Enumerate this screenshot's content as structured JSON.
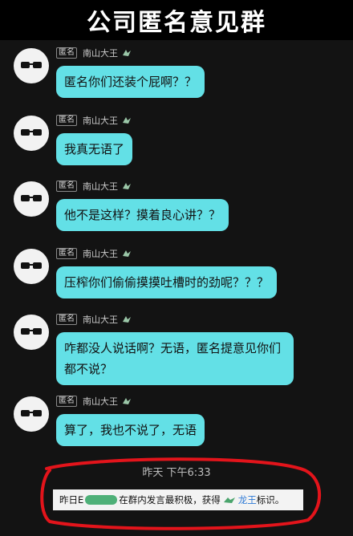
{
  "header": {
    "title": "公司匿名意见群"
  },
  "messages": [
    {
      "tag": "匿名",
      "sender": "南山大王",
      "text": "匿名你们还装个屁啊？？"
    },
    {
      "tag": "匿名",
      "sender": "南山大王",
      "text": "我真无语了"
    },
    {
      "tag": "匿名",
      "sender": "南山大王",
      "text": "他不是这样？摸着良心讲？？"
    },
    {
      "tag": "匿名",
      "sender": "南山大王",
      "text": "压榨你们偷偷摸摸吐槽时的劲呢？？？"
    },
    {
      "tag": "匿名",
      "sender": "南山大王",
      "text": "咋都没人说话啊？无语，匿名提意见你们都不说？"
    },
    {
      "tag": "匿名",
      "sender": "南山大王",
      "text": "算了，我也不说了，无语"
    }
  ],
  "timestamp": "昨天 下午6:33",
  "notice": {
    "prefix": "昨日",
    "redacted_first_char": "E",
    "middle": "在群内发言最积极，获得",
    "title": "龙王",
    "suffix": "标识。"
  },
  "colors": {
    "bubble": "#63e0e6",
    "background": "#131313",
    "annotation": "#e3141b"
  },
  "icons": {
    "avatar": "sunglasses-avatar-icon",
    "medal": "dragon-medal-icon"
  }
}
